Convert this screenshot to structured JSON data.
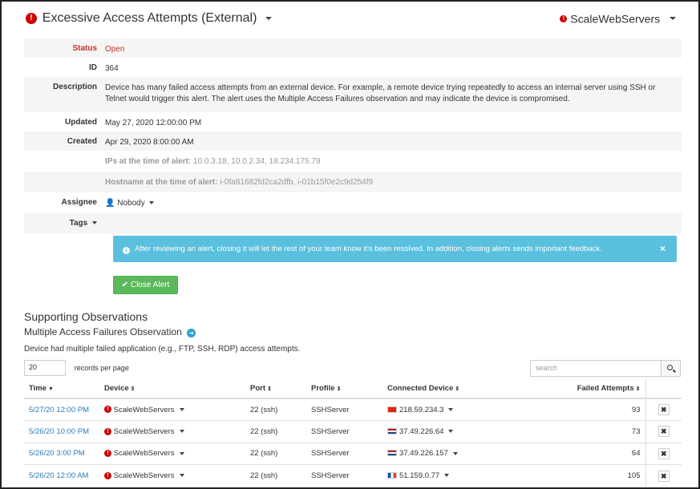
{
  "header": {
    "title": "Excessive Access Attempts (External)",
    "site": "ScaleWebServers"
  },
  "details": {
    "status_label": "Status",
    "status_value": "Open",
    "id_label": "ID",
    "id_value": "364",
    "description_label": "Description",
    "description_value": "Device has many failed access attempts from an external device. For example, a remote device trying repeatedly to access an internal server using SSH or Telnet would trigger this alert. The alert uses the Multiple Access Failures observation and may indicate the device is compromised.",
    "updated_label": "Updated",
    "updated_value": "May 27, 2020 12:00:00 PM",
    "created_label": "Created",
    "created_value": "Apr 29, 2020 8:00:00 AM",
    "ips_label": "IPs at the time of alert:",
    "ips_value": "10.0.3.18, 10.0.2.34, 18.234.175.79",
    "hostname_label": "Hostname at the time of alert:",
    "hostname_value": "i-0fa81682fd2ca2dfb, i-01b15f0e2c9d254f9",
    "assignee_label": "Assignee",
    "assignee_value": "Nobody",
    "tags_label": "Tags"
  },
  "info_message": "After reviewing an alert, closing it will let the rest of your team know it's been resolved. In addition, closing alerts sends important feedback.",
  "close_alert_label": "Close Alert",
  "observations": {
    "section_title": "Supporting Observations",
    "sub_title": "Multiple Access Failures Observation",
    "description": "Device had multiple failed application (e.g., FTP, SSH, RDP) access attempts.",
    "records_per_page_value": "20",
    "records_per_page_label": "records per page",
    "search_placeholder": "search",
    "columns": {
      "time": "Time",
      "device": "Device",
      "port": "Port",
      "profile": "Profile",
      "connected_device": "Connected Device",
      "failed_attempts": "Failed Attempts"
    },
    "rows": [
      {
        "time": "5/27/20 12:00 PM",
        "device": "ScaleWebServers",
        "port": "22 (ssh)",
        "profile": "SSHServer",
        "connected": "218.59.234.3",
        "flag": "cn",
        "failed": "93"
      },
      {
        "time": "5/26/20 10:00 PM",
        "device": "ScaleWebServers",
        "port": "22 (ssh)",
        "profile": "SSHServer",
        "connected": "37.49.226.64",
        "flag": "nl",
        "failed": "73"
      },
      {
        "time": "5/26/20 3:00 PM",
        "device": "ScaleWebServers",
        "port": "22 (ssh)",
        "profile": "SSHServer",
        "connected": "37.49.226.157",
        "flag": "nl",
        "failed": "64"
      },
      {
        "time": "5/26/20 12:00 AM",
        "device": "ScaleWebServers",
        "port": "22 (ssh)",
        "profile": "SSHServer",
        "connected": "51.159.0.77",
        "flag": "fr",
        "failed": "105"
      }
    ]
  },
  "colors": {
    "danger": "#c9302c",
    "info": "#5bc0de",
    "success": "#5cb85c",
    "link": "#2a7ab8"
  }
}
